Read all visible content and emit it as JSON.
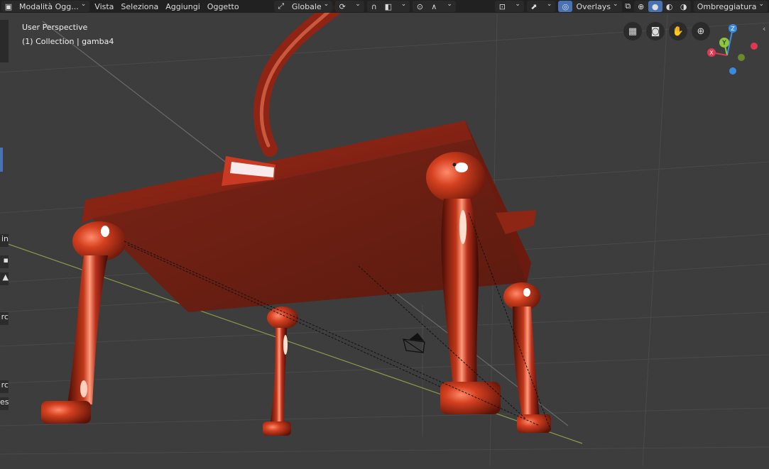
{
  "header": {
    "mode_label": "Modalità Ogg...",
    "menu_view": "Vista",
    "menu_select": "Seleziona",
    "menu_add": "Aggiungi",
    "menu_object": "Oggetto",
    "orientation_label": "Globale",
    "overlays_label": "Overlays",
    "shading_label": "Ombreggiatura"
  },
  "viewport": {
    "perspective_label": "User Perspective",
    "collection_label": "(1) Collection | gamba4"
  },
  "gizmo": {
    "z_label": "Z",
    "y_label": "Y",
    "x_label": "X",
    "colors": {
      "x": "#e0394f",
      "y": "#8cc63f",
      "z": "#3b8be0"
    }
  },
  "left_panel": {
    "tab_1": "in",
    "tab_2": "rc",
    "tab_3": "rc",
    "tab_4": "es"
  },
  "icons": {
    "editor_type": "cube-icon",
    "pivot": "pivot-icon",
    "snap": "magnet-icon",
    "proportional": "proportional-edit-icon",
    "visibility": "eye-icon",
    "gizmo_toggle": "gizmo-icon",
    "xray": "xray-icon",
    "grid_view": "grid-icon",
    "camera_view": "camera-icon",
    "pan": "hand-icon",
    "zoom": "zoom-icon"
  },
  "scene": {
    "object_color": "#b8301c",
    "background_color": "#3d3d3d"
  }
}
